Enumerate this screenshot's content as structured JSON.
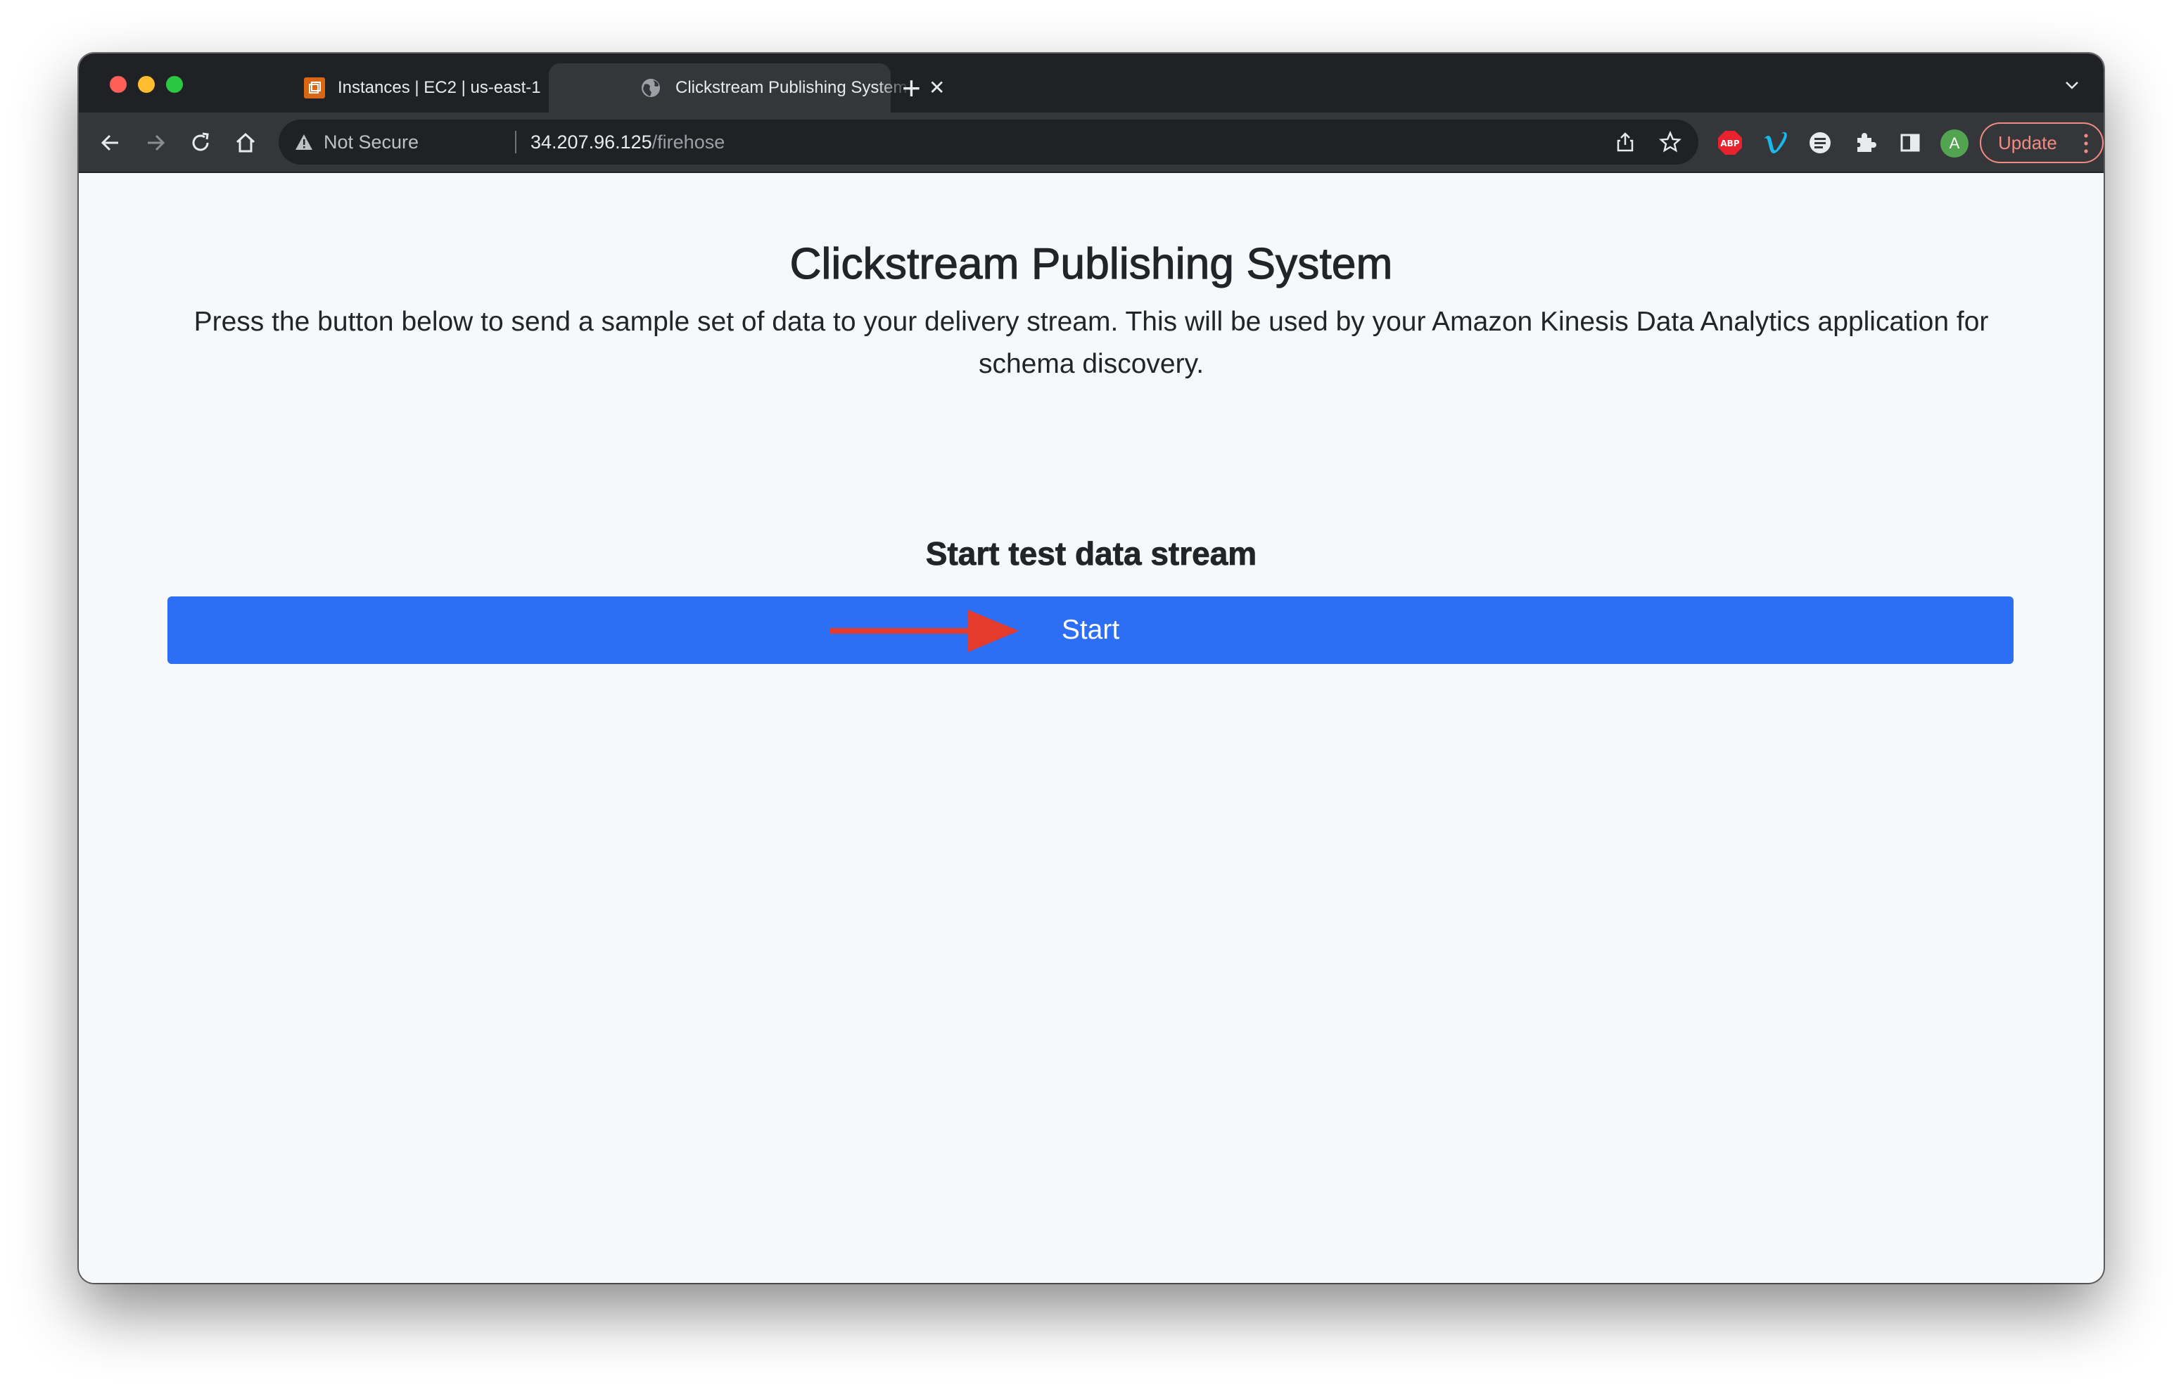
{
  "browser": {
    "tabs": [
      {
        "title": "Instances | EC2 | us-east-1",
        "active": false,
        "favicon": "aws-ec2-icon"
      },
      {
        "title": "Clickstream Publishing System",
        "active": true,
        "favicon": "globe-icon"
      }
    ],
    "address_bar": {
      "security_label": "Not Secure",
      "host": "34.207.96.125",
      "path": "/firehose"
    },
    "profile_initial": "A",
    "update_label": "Update",
    "extensions": [
      "adblock-plus-icon",
      "vimeo-icon",
      "extension-circle-icon",
      "puzzle-extensions-icon",
      "side-panel-icon"
    ]
  },
  "page": {
    "title": "Clickstream Publishing System",
    "description": "Press the button below to send a sample set of data to your delivery stream. This will be used by your Amazon Kinesis Data Analytics application for schema discovery.",
    "section_title": "Start test data stream",
    "start_button": "Start"
  },
  "colors": {
    "button_blue": "#2d6ff4",
    "annotation_arrow": "#e53b2c",
    "update_accent": "#f28b82"
  }
}
